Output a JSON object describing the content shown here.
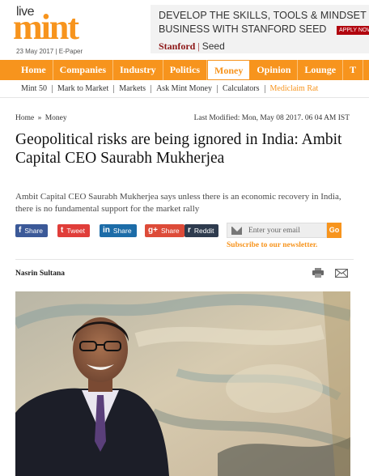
{
  "header": {
    "logo_live": "live",
    "logo_mint": "mint",
    "dateline": "23 May 2017 | E-Paper"
  },
  "ad": {
    "line1": "DEVELOP THE SKILLS, TOOLS & MINDSET TO",
    "line2": "BUSINESS WITH STANFORD SEED",
    "cta": "APPLY NOW",
    "brand_stanford": "Stanford",
    "brand_sep": "|",
    "brand_seed": "Seed"
  },
  "nav": {
    "items": [
      "Home",
      "Companies",
      "Industry",
      "Politics",
      "Money",
      "Opinion",
      "Lounge",
      "T"
    ],
    "active": "Money"
  },
  "subnav": {
    "items": [
      "Mint 50",
      "Mark to Market",
      "Markets",
      "Ask Mint Money",
      "Calculators"
    ],
    "promo": "Mediclaim Rat"
  },
  "article": {
    "breadcrumb_home": "Home",
    "breadcrumb_sep": "»",
    "breadcrumb_section": "Money",
    "last_modified": "Last Modified: Mon, May 08 2017. 06 04 AM IST",
    "title": "Geopolitical risks are being ignored in India: Ambit Capital CEO Saurabh Mukherjea",
    "summary": "Ambit Capital CEO Saurabh Mukherjea says unless there is an economic recovery in India, there is no fundamental support for the market rally",
    "author": "Nasrin Sultana"
  },
  "share": {
    "facebook": {
      "icon": "f",
      "label": "Share"
    },
    "twitter": {
      "icon": "t",
      "label": "Tweet"
    },
    "linkedin": {
      "icon": "in",
      "label": "Share"
    },
    "googleplus": {
      "icon": "g+",
      "label": "Share"
    },
    "reddit": {
      "icon": "r",
      "label": "Reddit"
    }
  },
  "newsletter": {
    "placeholder": "Enter your email",
    "go_label": "Go",
    "subscribe_label": "Subscribe to our newsletter."
  },
  "colors": {
    "brand_orange": "#f7941d",
    "facebook": "#3b5998",
    "twitter": "#e03e3a",
    "linkedin": "#1c6ca8",
    "googleplus": "#dd4b39",
    "reddit": "#2e3b4e"
  }
}
